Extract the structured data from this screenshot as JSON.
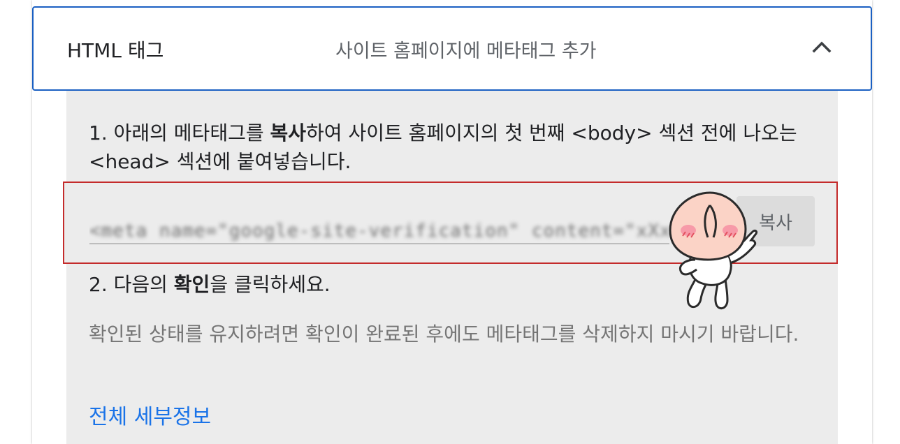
{
  "header": {
    "title": "HTML 태그",
    "subtitle": "사이트 홈페이지에 메타태그 추가"
  },
  "step1": {
    "prefix": "1. 아래의 메타태그를 ",
    "bold": "복사",
    "suffix": "하여 사이트 홈페이지의 첫 번째 <body> 섹션 전에 나오는 <head> 섹션에 붙여넣습니다."
  },
  "meta_tag": {
    "value": "<meta name=\"google-site-verification\" content=\"xXxXxXxXxXx\" />"
  },
  "copy_button": {
    "label": "복사"
  },
  "step2": {
    "prefix": "2. 다음의 ",
    "bold": "확인",
    "suffix": "을 클릭하세요."
  },
  "note": "확인된 상태를 유지하려면 확인이 완료된 후에도 메타태그를 삭제하지 마시기 바랍니다.",
  "details_link": "전체 세부정보",
  "colors": {
    "accent": "#1a5fc2",
    "link": "#1a73e8",
    "highlight_border": "#c42b2b",
    "content_bg": "#ececec"
  },
  "icons": {
    "collapse": "chevron-up-icon",
    "sticker": "peach-character-sticker"
  }
}
